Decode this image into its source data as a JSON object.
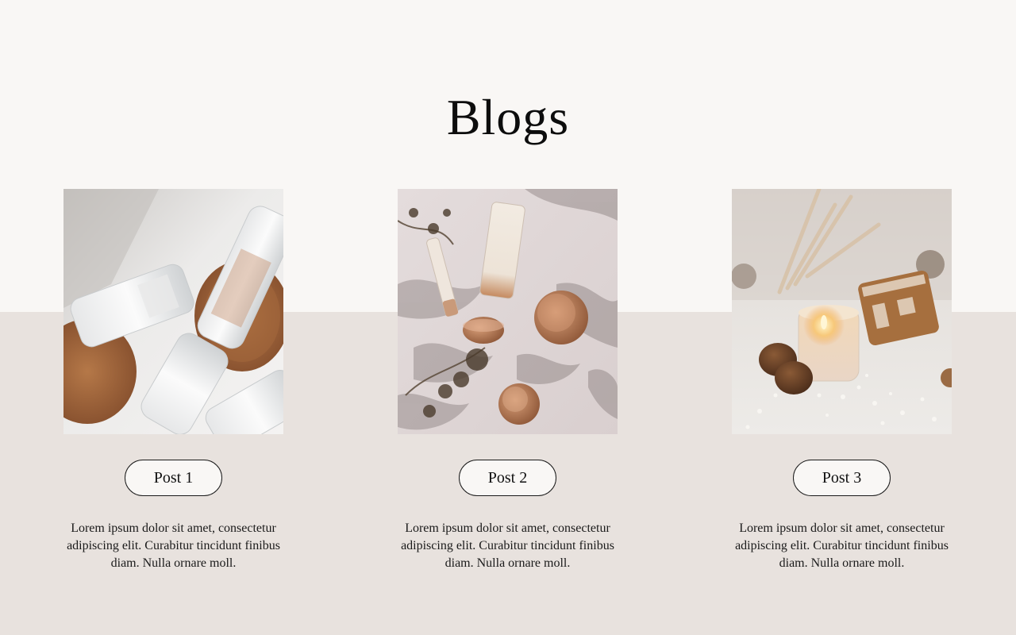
{
  "page": {
    "title": "Blogs",
    "colors": {
      "top_background": "#f9f7f5",
      "bottom_background": "#e8e2de",
      "text": "#111111"
    }
  },
  "posts": [
    {
      "button_label": "Post 1",
      "excerpt": "Lorem ipsum dolor sit amet, consectetur adipiscing elit. Curabitur tincidunt finibus diam. Nulla ornare moll.",
      "image_subject": "glass bottles on cork coasters"
    },
    {
      "button_label": "Post 2",
      "excerpt": "Lorem ipsum dolor sit amet, consectetur adipiscing elit. Curabitur tincidunt finibus diam. Nulla ornare moll.",
      "image_subject": "skincare tubes and copper jars with leaf shadows"
    },
    {
      "button_label": "Post 3",
      "excerpt": "Lorem ipsum dolor sit amet, consectetur adipiscing elit. Curabitur tincidunt finibus diam. Nulla ornare moll.",
      "image_subject": "lit candle with walnuts and gingerbread"
    }
  ]
}
